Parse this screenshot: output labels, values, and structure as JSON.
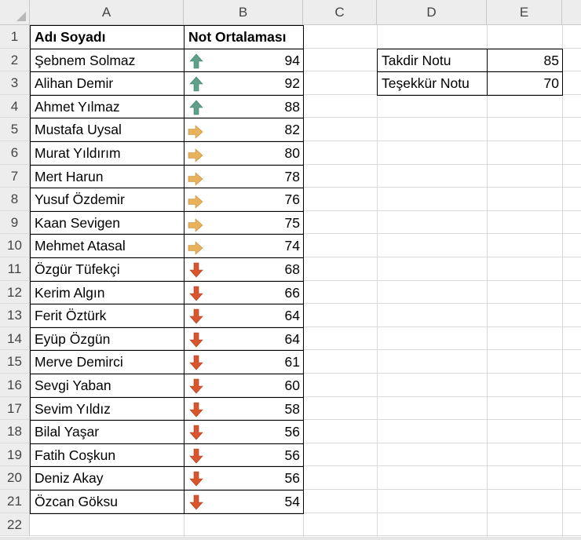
{
  "columns": [
    "A",
    "B",
    "C",
    "D",
    "E"
  ],
  "rows": [
    "1",
    "2",
    "3",
    "4",
    "5",
    "6",
    "7",
    "8",
    "9",
    "10",
    "11",
    "12",
    "13",
    "14",
    "15",
    "16",
    "17",
    "18",
    "19",
    "20",
    "21",
    "22"
  ],
  "headers": {
    "name": "Adı Soyadı",
    "grade": "Not Ortalaması"
  },
  "students": [
    {
      "name": "Şebnem Solmaz",
      "grade": "94",
      "trend": "up"
    },
    {
      "name": "Alihan Demir",
      "grade": "92",
      "trend": "up"
    },
    {
      "name": "Ahmet Yılmaz",
      "grade": "88",
      "trend": "up"
    },
    {
      "name": "Mustafa Uysal",
      "grade": "82",
      "trend": "right"
    },
    {
      "name": "Murat Yıldırım",
      "grade": "80",
      "trend": "right"
    },
    {
      "name": "Mert Harun",
      "grade": "78",
      "trend": "right"
    },
    {
      "name": "Yusuf Özdemir",
      "grade": "76",
      "trend": "right"
    },
    {
      "name": "Kaan Sevigen",
      "grade": "75",
      "trend": "right"
    },
    {
      "name": "Mehmet Atasal",
      "grade": "74",
      "trend": "right"
    },
    {
      "name": "Özgür Tüfekçi",
      "grade": "68",
      "trend": "down"
    },
    {
      "name": "Kerim Algın",
      "grade": "66",
      "trend": "down"
    },
    {
      "name": "Ferit Öztürk",
      "grade": "64",
      "trend": "down"
    },
    {
      "name": "Eyüp Özgün",
      "grade": "64",
      "trend": "down"
    },
    {
      "name": "Merve Demirci",
      "grade": "61",
      "trend": "down"
    },
    {
      "name": "Sevgi Yaban",
      "grade": "60",
      "trend": "down"
    },
    {
      "name": "Sevim Yıldız",
      "grade": "58",
      "trend": "down"
    },
    {
      "name": "Bilal Yaşar",
      "grade": "56",
      "trend": "down"
    },
    {
      "name": "Fatih Coşkun",
      "grade": "56",
      "trend": "down"
    },
    {
      "name": "Deniz Akay",
      "grade": "56",
      "trend": "down"
    },
    {
      "name": "Özcan Göksu",
      "grade": "54",
      "trend": "down"
    }
  ],
  "thresholds": [
    {
      "label": "Takdir Notu",
      "value": "85"
    },
    {
      "label": "Teşekkür Notu",
      "value": "70"
    }
  ],
  "icons": {
    "up": {
      "name": "arrow-up-icon",
      "color": "#5fa08a"
    },
    "right": {
      "name": "arrow-right-icon",
      "color": "#e8b15a"
    },
    "down": {
      "name": "arrow-down-icon",
      "color": "#d9552e"
    }
  }
}
